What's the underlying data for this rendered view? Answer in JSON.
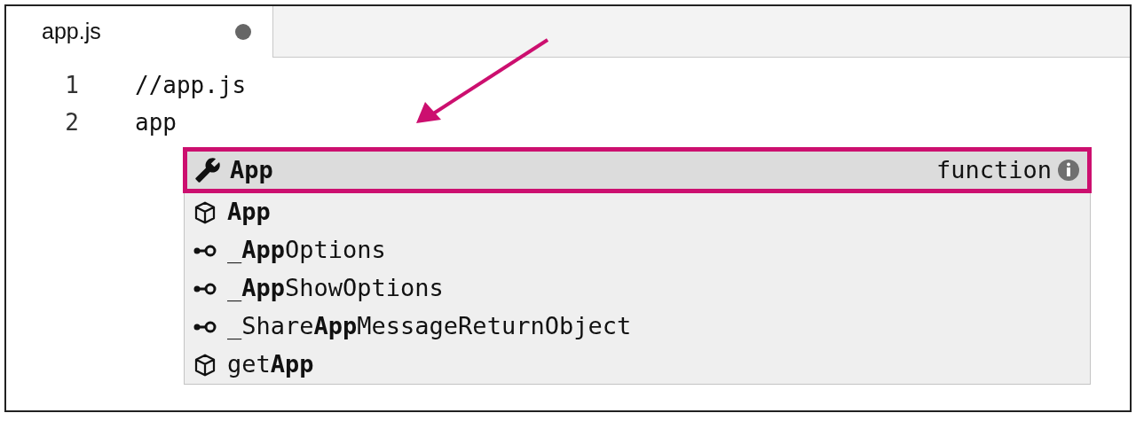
{
  "tab": {
    "title": "app.js",
    "dirty": true
  },
  "lines": [
    {
      "number": "1",
      "text": "//app.js"
    },
    {
      "number": "2",
      "text": "app"
    }
  ],
  "suggestions": [
    {
      "kind": "method",
      "label": "**App**",
      "detail": "function",
      "selected": true
    },
    {
      "kind": "class",
      "label": "**App**",
      "selected": false
    },
    {
      "kind": "field",
      "label": "_**App**Options",
      "selected": false
    },
    {
      "kind": "field",
      "label": "_**App**ShowOptions",
      "selected": false
    },
    {
      "kind": "field",
      "label": "_Share**App**MessageReturnObject",
      "selected": false
    },
    {
      "kind": "class",
      "label": "get**App**",
      "selected": false
    }
  ]
}
